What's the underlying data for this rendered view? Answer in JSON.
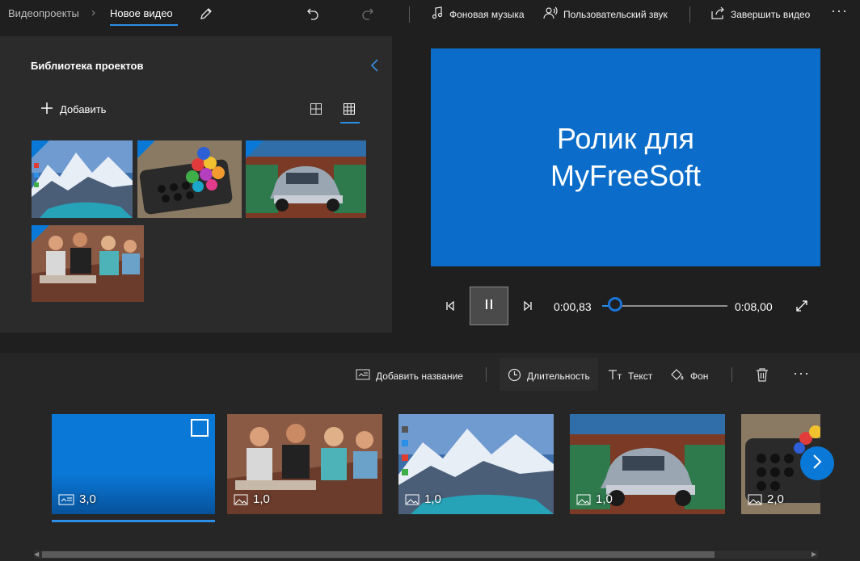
{
  "topbar": {
    "breadcrumb_root": "Видеопроекты",
    "breadcrumb_current": "Новое видео",
    "background_music": "Фоновая музыка",
    "custom_audio": "Пользовательский звук",
    "finish_video": "Завершить видео",
    "icons": [
      "pencil-icon",
      "undo-icon",
      "redo-icon",
      "music-note-icon",
      "person-audio-icon",
      "share-icon",
      "more-icon"
    ]
  },
  "library": {
    "title": "Библиотека проектов",
    "add_label": "Добавить",
    "items": [
      "mountains",
      "beads",
      "old-car",
      "people-on-steps"
    ]
  },
  "preview": {
    "title_text": "Ролик для\nMyFreeSoft",
    "current_time": "0:00,83",
    "total_time": "0:08,00",
    "progress": 0.104
  },
  "storyboard": {
    "toolbar": {
      "add_title": "Добавить название",
      "duration": "Длительность",
      "text": "Текст",
      "background": "Фон"
    },
    "cards": [
      {
        "type": "title-card",
        "duration": "3,0",
        "selected": true
      },
      {
        "type": "people",
        "duration": "1,0"
      },
      {
        "type": "mountains",
        "duration": "1,0"
      },
      {
        "type": "old-car",
        "duration": "1,0"
      },
      {
        "type": "beads",
        "duration": "2,0"
      }
    ]
  },
  "colors": {
    "accent": "#0a78d7",
    "preview_bg": "#0b6dc9",
    "background": "#1f1f1f",
    "panel": "#2b2b2b"
  }
}
